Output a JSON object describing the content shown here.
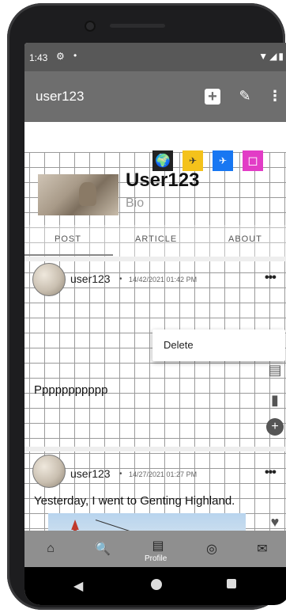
{
  "status_bar": {
    "time": "1:43",
    "icons": [
      "gear-icon",
      "notification-dot",
      "wifi-icon",
      "signal-icon",
      "battery-icon"
    ]
  },
  "app_bar": {
    "title": "user123",
    "actions": [
      "add-icon",
      "edit-icon",
      "more-vert-icon"
    ]
  },
  "profile": {
    "name": "User123",
    "bio": "Bio",
    "quick_icons": [
      "globe-icon",
      "travel-icon",
      "flight-icon",
      "bookmark-icon"
    ]
  },
  "tabs": [
    {
      "label": "POST",
      "selected": true
    },
    {
      "label": "ARTICLE",
      "selected": false
    },
    {
      "label": "ABOUT",
      "selected": false
    }
  ],
  "posts": [
    {
      "username": "user123",
      "separator": "•",
      "timestamp": "14/42/2021 01:42 PM",
      "more": "•••",
      "text": "Ppppppppppp"
    },
    {
      "username": "user123",
      "separator": "•",
      "timestamp": "14/27/2021 01:27 PM",
      "more": "•••",
      "text": "Yesterday, I went to Genting Highland."
    }
  ],
  "context_menu": {
    "items": [
      "Delete"
    ]
  },
  "bottom_nav": {
    "profile_label": "Profile",
    "items": [
      "home-icon",
      "search-icon",
      "profile-icon",
      "camera-icon",
      "mail-icon"
    ]
  },
  "colors": {
    "app_bar": "#6e6e6e",
    "status_bar": "#585858",
    "bottom_nav": "#8f8f8f"
  }
}
